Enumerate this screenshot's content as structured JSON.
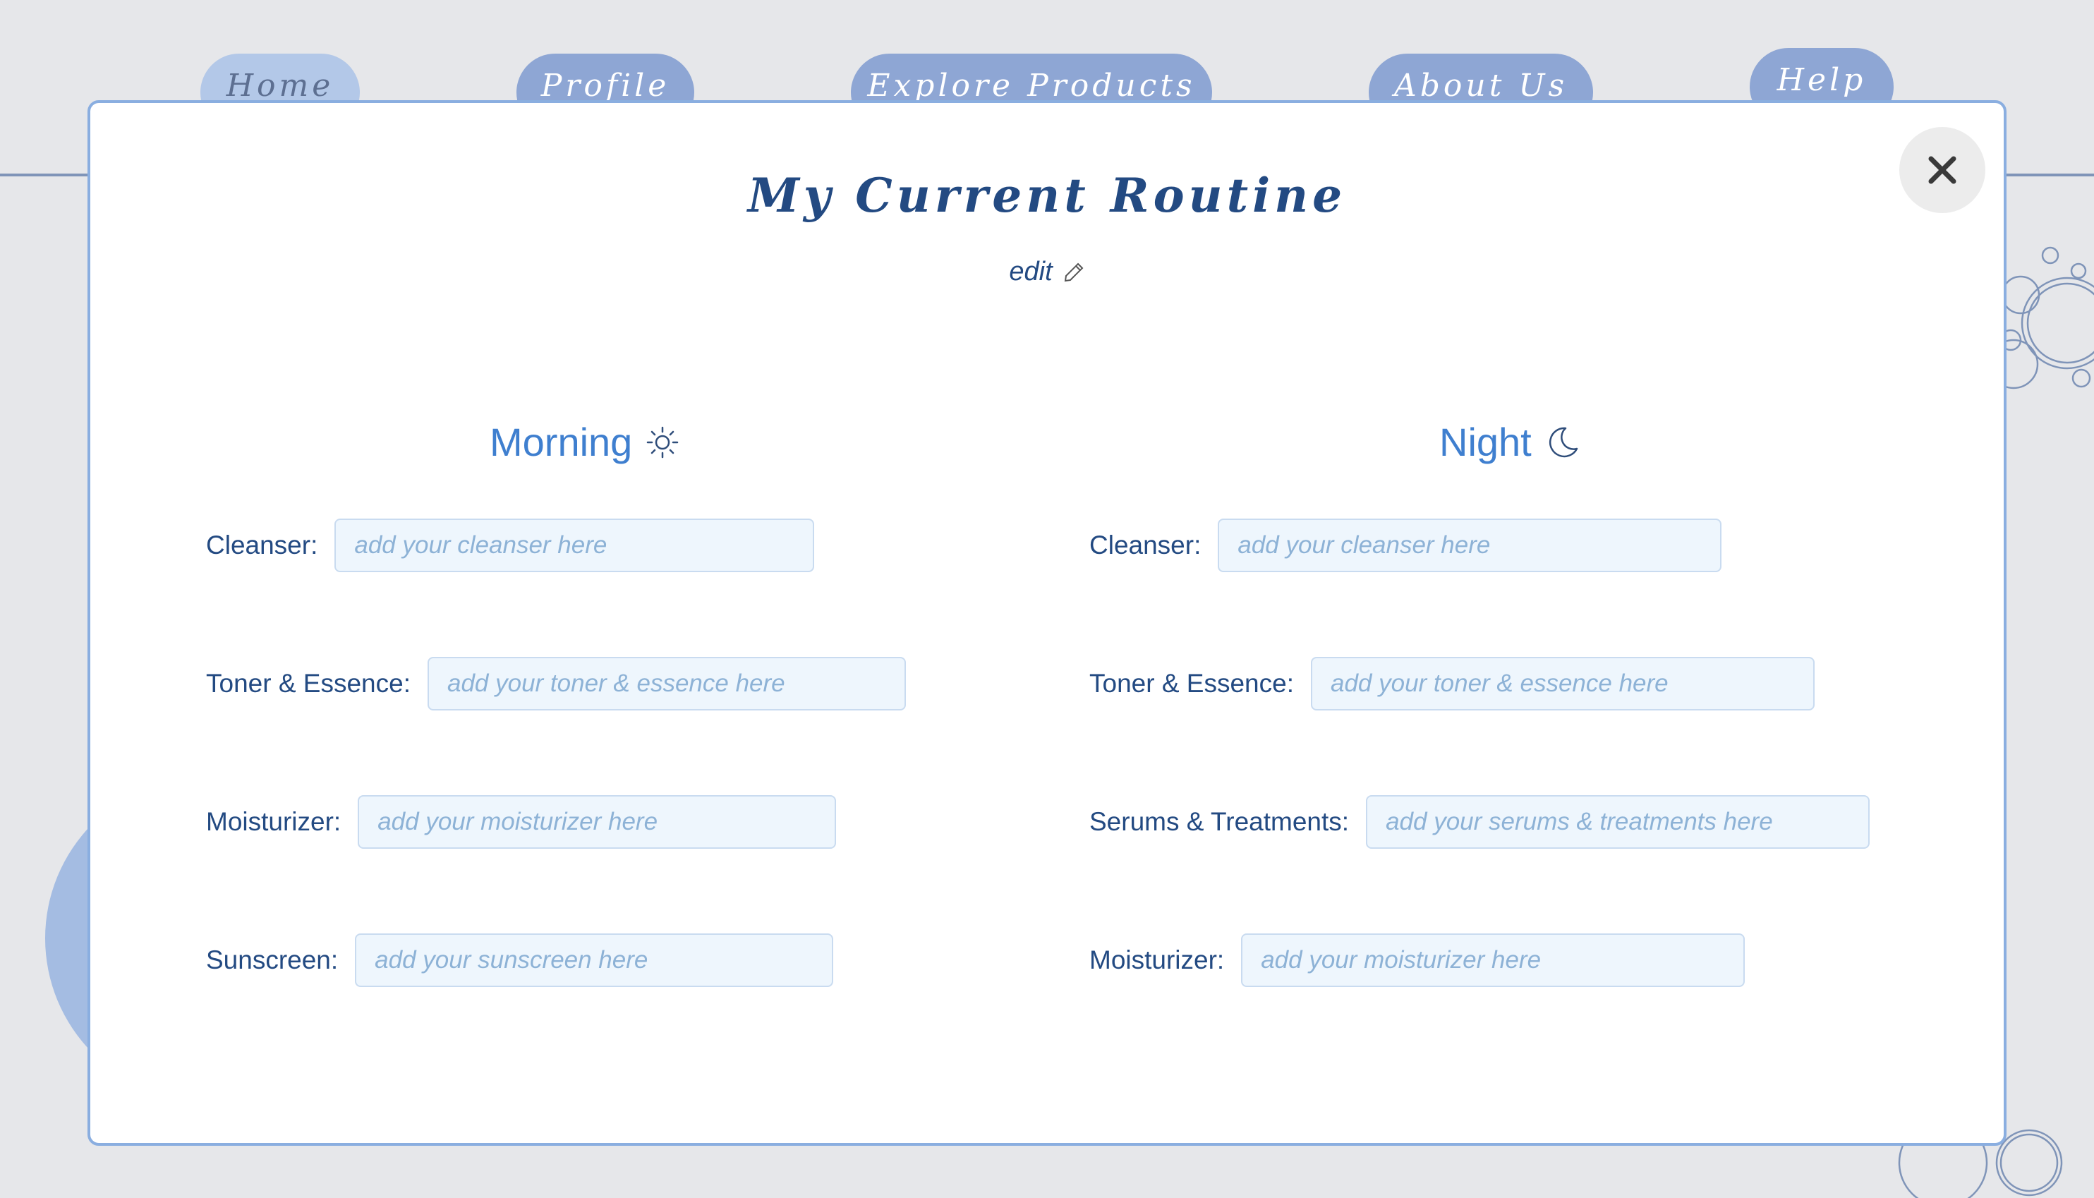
{
  "nav": {
    "items": [
      {
        "label": "Home"
      },
      {
        "label": "Profile"
      },
      {
        "label": "Explore Products"
      },
      {
        "label": "About Us"
      },
      {
        "label": "Help"
      }
    ]
  },
  "modal": {
    "title": "My Current Routine",
    "edit_label": "edit",
    "close_icon": "close-icon",
    "morning": {
      "heading": "Morning",
      "icon": "sun-icon",
      "fields": [
        {
          "label": "Cleanser:",
          "placeholder": "add your cleanser here",
          "value": ""
        },
        {
          "label": "Toner & Essence:",
          "placeholder": "add your toner & essence here",
          "value": ""
        },
        {
          "label": "Moisturizer:",
          "placeholder": "add your moisturizer here",
          "value": ""
        },
        {
          "label": "Sunscreen:",
          "placeholder": "add your sunscreen here",
          "value": ""
        }
      ]
    },
    "night": {
      "heading": "Night",
      "icon": "moon-icon",
      "fields": [
        {
          "label": "Cleanser:",
          "placeholder": "add your cleanser here",
          "value": ""
        },
        {
          "label": "Toner & Essence:",
          "placeholder": "add your toner & essence here",
          "value": ""
        },
        {
          "label": "Serums & Treatments:",
          "placeholder": "add your serums & treatments here",
          "value": ""
        },
        {
          "label": "Moisturizer:",
          "placeholder": "add your moisturizer here",
          "value": ""
        }
      ]
    }
  },
  "colors": {
    "background": "#e6e7ea",
    "nav_pill": "#8ea6d4",
    "nav_pill_active": "#b3c8e8",
    "title": "#234a82",
    "accent": "#3f7fcf",
    "input_bg": "#eef6fd",
    "modal_border": "#8aaee0"
  }
}
